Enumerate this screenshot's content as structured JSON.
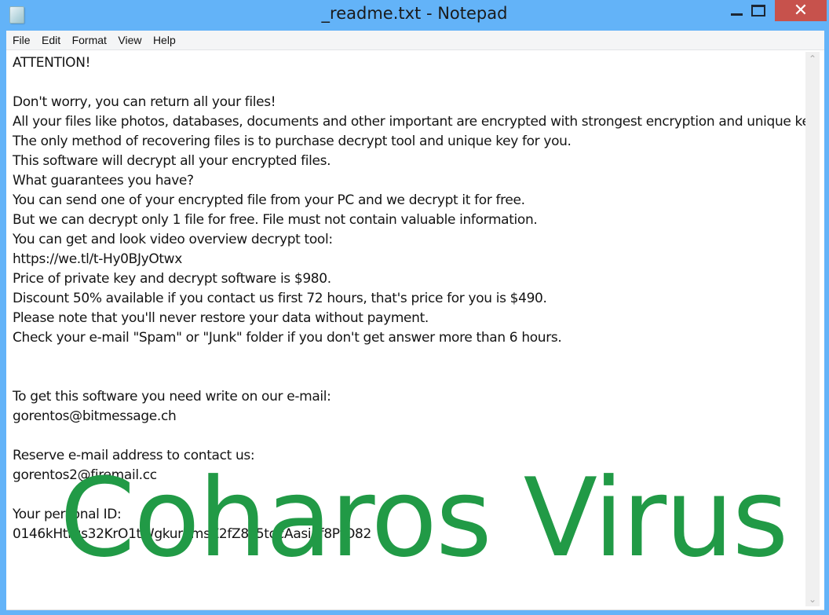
{
  "window": {
    "title": "_readme.txt - Notepad",
    "icon": "notepad-icon",
    "controls": {
      "minimize": "minimize-icon",
      "maximize": "maximize-icon",
      "close": "✕"
    }
  },
  "menu": {
    "items": [
      "File",
      "Edit",
      "Format",
      "View",
      "Help"
    ]
  },
  "document": {
    "lines": [
      "ATTENTION!",
      "",
      "Don't worry, you can return all your files!",
      "All your files like photos, databases, documents and other important are encrypted with strongest encryption and unique key.",
      "The only method of recovering files is to purchase decrypt tool and unique key for you.",
      "This software will decrypt all your encrypted files.",
      "What guarantees you have?",
      "You can send one of your encrypted file from your PC and we decrypt it for free.",
      "But we can decrypt only 1 file for free. File must not contain valuable information.",
      "You can get and look video overview decrypt tool:",
      "https://we.tl/t-Hy0BJyOtwx",
      "Price of private key and decrypt software is $980.",
      "Discount 50% available if you contact us first 72 hours, that's price for you is $490.",
      "Please note that you'll never restore your data without payment.",
      "Check your e-mail \"Spam\" or \"Junk\" folder if you don't get answer more than 6 hours.",
      "",
      "",
      "To get this software you need write on our e-mail:",
      "gorentos@bitmessage.ch",
      "",
      "Reserve e-mail address to contact us:",
      "gorentos2@firemail.cc",
      "",
      "Your personal ID:",
      "0146kHtrus32KrO1tWgkurnmsZ2fZ8iJ5tqcAasinf8PtO82"
    ]
  },
  "scrollbar": {
    "up": "⌃",
    "down": "⌄"
  },
  "watermark": {
    "text": "Coharos Virus",
    "color": "#219a46"
  }
}
